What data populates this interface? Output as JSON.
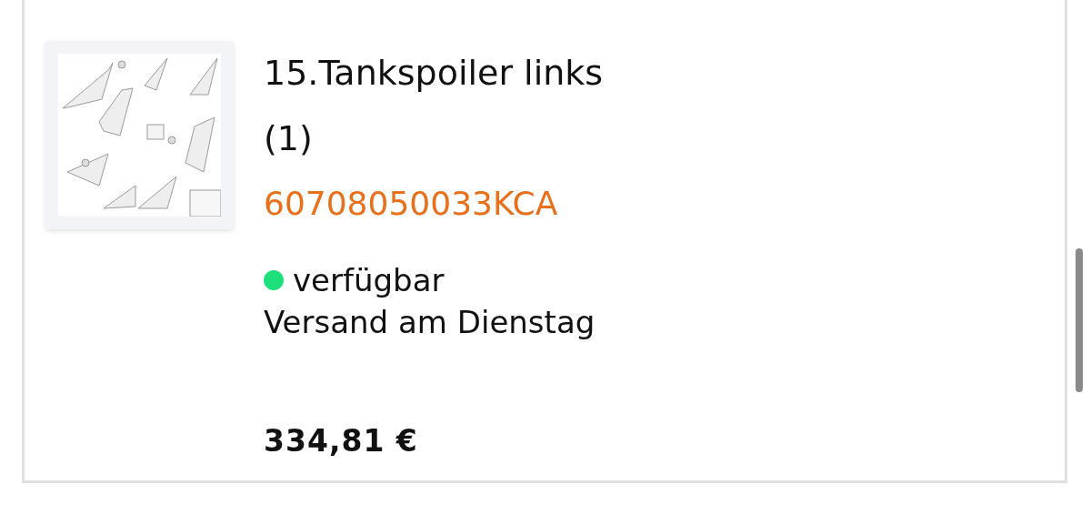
{
  "product": {
    "title": "15.Tankspoiler links",
    "quantity": "(1)",
    "part_number": "60708050033KCA",
    "availability": {
      "label": "verfügbar",
      "color": "#1ee07a"
    },
    "shipping": "Versand am Dienstag",
    "price": "334,81 €"
  }
}
